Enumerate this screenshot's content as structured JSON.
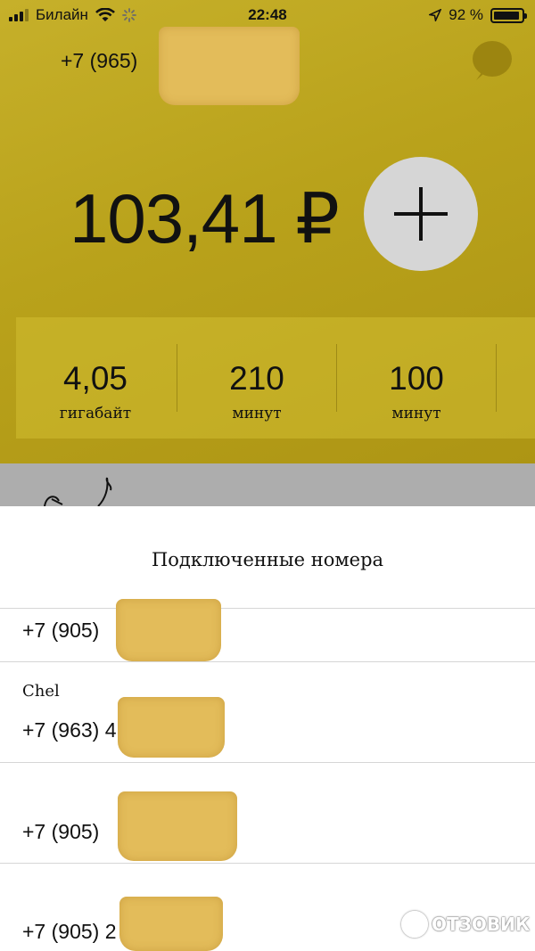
{
  "status_bar": {
    "carrier": "Билайн",
    "time": "22:48",
    "battery_percent": "92 %",
    "battery_level": 0.92
  },
  "account": {
    "phone_prefix": "+7 (965)"
  },
  "balance": {
    "amount": "103,41 ₽"
  },
  "quotas": [
    {
      "value": "4,05",
      "unit": "гигабайт"
    },
    {
      "value": "210",
      "unit": "минут"
    },
    {
      "value": "100",
      "unit": "минут"
    }
  ],
  "sheet": {
    "title": "Подключенные номера",
    "numbers": [
      {
        "name": "",
        "phone": "+7 (905)"
      },
      {
        "name": "Chel",
        "phone": "+7 (963) 4"
      },
      {
        "name": "",
        "phone": "+7 (905)"
      },
      {
        "name": "",
        "phone": "+7 (905) 2"
      }
    ]
  },
  "watermark": {
    "text": "ОТЗОВИК"
  },
  "colors": {
    "header_yellow": "#b9a21b",
    "plus_button": "#d6d6d6",
    "sheet_background": "#ffffff"
  },
  "icons": [
    "wifi-icon",
    "loading-spinner-icon",
    "location-arrow-icon",
    "battery-icon",
    "chat-bubble-icon",
    "plus-icon"
  ]
}
